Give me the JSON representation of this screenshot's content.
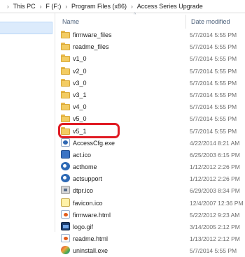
{
  "breadcrumb": {
    "items": [
      "This PC",
      "F (F:)",
      "Program Files (x86)",
      "Access Series Upgrade"
    ]
  },
  "columns": {
    "name": "Name",
    "date": "Date modified"
  },
  "colors": {
    "highlight": "#e01b24",
    "folder": "#f3cc63",
    "nav_selection": "#dcebfc"
  },
  "files": [
    {
      "name": "firmware_files",
      "date": "5/7/2014 5:55 PM",
      "icon": "folder-icon"
    },
    {
      "name": "readme_files",
      "date": "5/7/2014 5:55 PM",
      "icon": "folder-icon"
    },
    {
      "name": "v1_0",
      "date": "5/7/2014 5:55 PM",
      "icon": "folder-icon"
    },
    {
      "name": "v2_0",
      "date": "5/7/2014 5:55 PM",
      "icon": "folder-icon"
    },
    {
      "name": "v3_0",
      "date": "5/7/2014 5:55 PM",
      "icon": "folder-icon"
    },
    {
      "name": "v3_1",
      "date": "5/7/2014 5:55 PM",
      "icon": "folder-icon"
    },
    {
      "name": "v4_0",
      "date": "5/7/2014 5:55 PM",
      "icon": "folder-icon"
    },
    {
      "name": "v5_0",
      "date": "5/7/2014 5:55 PM",
      "icon": "folder-icon"
    },
    {
      "name": "v5_1",
      "date": "5/7/2014 5:55 PM",
      "icon": "folder-icon"
    },
    {
      "name": "AccessCfg.exe",
      "date": "4/22/2014 8:21 AM",
      "icon": "exe-icon",
      "highlighted": true
    },
    {
      "name": "act.ico",
      "date": "6/25/2003 6:15 PM",
      "icon": "ico-icon"
    },
    {
      "name": "acthome",
      "date": "1/12/2012 2:26 PM",
      "icon": "activex-icon"
    },
    {
      "name": "actsupport",
      "date": "1/12/2012 2:26 PM",
      "icon": "activex-icon"
    },
    {
      "name": "dtpr.ico",
      "date": "6/29/2003 8:34 PM",
      "icon": "ico-icon"
    },
    {
      "name": "favicon.ico",
      "date": "12/4/2007 12:36 PM",
      "icon": "ico-icon"
    },
    {
      "name": "firmware.html",
      "date": "5/22/2012 9:23 AM",
      "icon": "html-icon"
    },
    {
      "name": "logo.gif",
      "date": "3/14/2005 2:12 PM",
      "icon": "gif-icon"
    },
    {
      "name": "readme.html",
      "date": "1/13/2012 2:12 PM",
      "icon": "html-icon"
    },
    {
      "name": "uninstall.exe",
      "date": "5/7/2014 5:55 PM",
      "icon": "uninstall-icon"
    }
  ]
}
